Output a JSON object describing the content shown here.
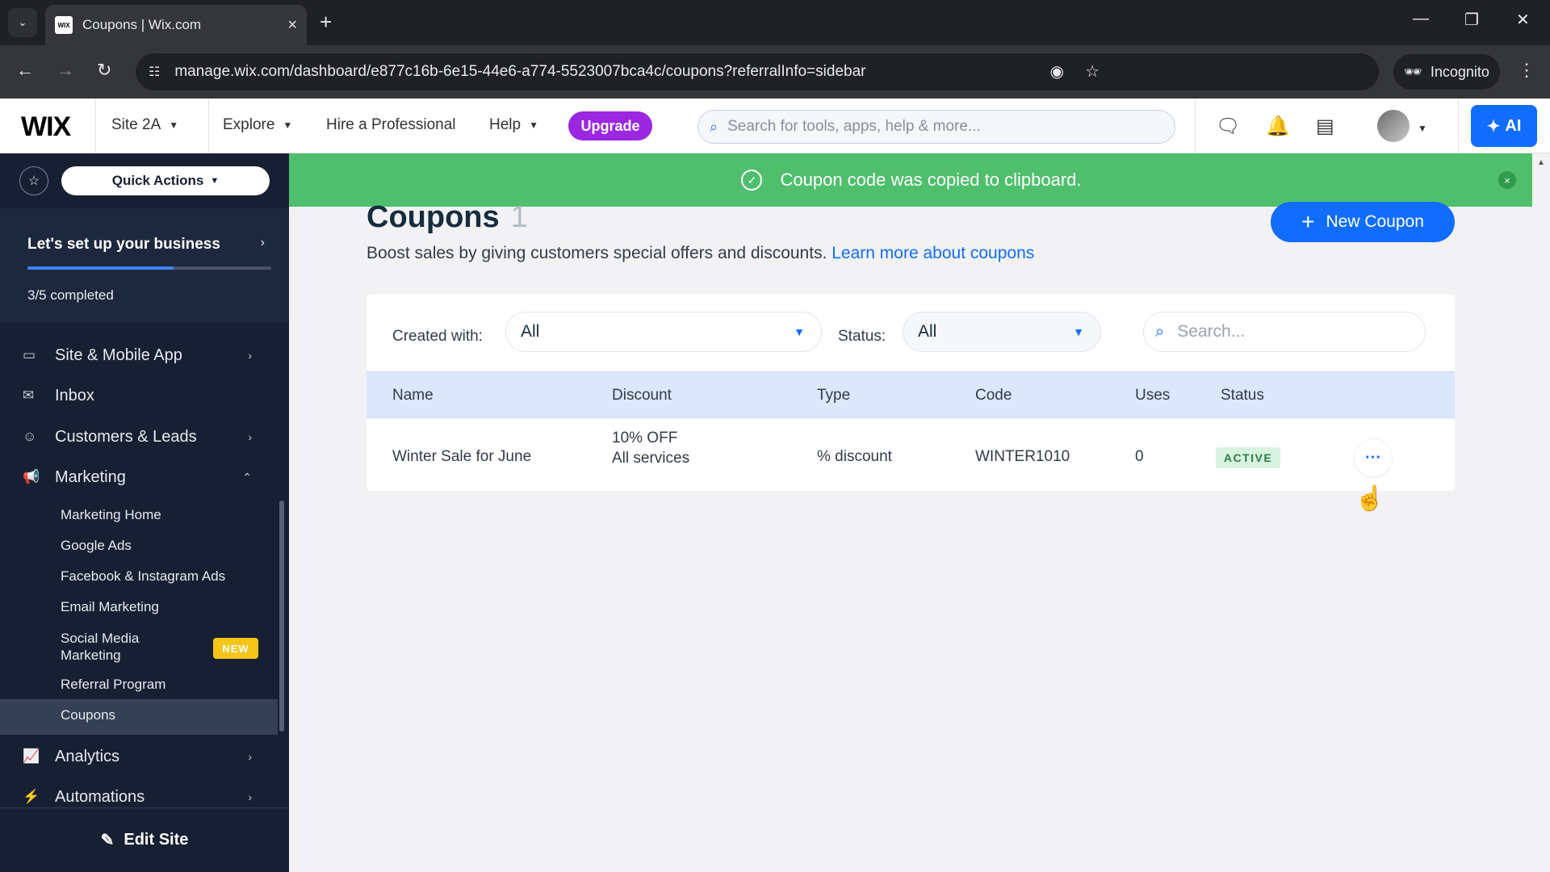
{
  "browser": {
    "tab_title": "Coupons | Wix.com",
    "favicon_text": "WIX",
    "url": "manage.wix.com/dashboard/e877c16b-6e15-44e6-a774-5523007bca4c/coupons?referralInfo=sidebar",
    "incognito_label": "Incognito"
  },
  "topbar": {
    "logo": "WIX",
    "site_name": "Site 2A",
    "explore": "Explore",
    "hire": "Hire a Professional",
    "help": "Help",
    "upgrade": "Upgrade",
    "search_placeholder": "Search for tools, apps, help & more...",
    "ai_label": "AI"
  },
  "sidebar": {
    "quick_actions": "Quick Actions",
    "setup_title": "Let's set up your business",
    "setup_progress_text": "3/5 completed",
    "setup_progress_fraction": 0.6,
    "items": [
      {
        "label": "Site & Mobile App",
        "icon": "site-icon"
      },
      {
        "label": "Inbox",
        "icon": "inbox-icon"
      },
      {
        "label": "Customers & Leads",
        "icon": "customers-icon"
      },
      {
        "label": "Marketing",
        "icon": "marketing-icon"
      },
      {
        "label": "Analytics",
        "icon": "analytics-icon"
      },
      {
        "label": "Automations",
        "icon": "automations-icon"
      }
    ],
    "marketing_sub": [
      "Marketing Home",
      "Google Ads",
      "Facebook & Instagram Ads",
      "Email Marketing",
      "Social Media Marketing",
      "Referral Program",
      "Coupons"
    ],
    "social_line1": "Social Media",
    "social_line2": "Marketing",
    "new_badge": "NEW",
    "edit_site": "Edit Site"
  },
  "toast": {
    "message": "Coupon code was copied to clipboard."
  },
  "page": {
    "title": "Coupons",
    "count": "1",
    "description": "Boost sales by giving customers special offers and discounts.",
    "learn_more": "Learn more about coupons",
    "new_coupon": "New Coupon"
  },
  "filters": {
    "created_with_label": "Created with:",
    "created_with_value": "All",
    "status_label": "Status:",
    "status_value": "All",
    "search_placeholder": "Search..."
  },
  "table": {
    "headers": [
      "Name",
      "Discount",
      "Type",
      "Code",
      "Uses",
      "Status"
    ],
    "rows": [
      {
        "name": "Winter Sale for June",
        "discount_line1": "10% OFF",
        "discount_line2": "All services",
        "type": "% discount",
        "code": "WINTER1010",
        "uses": "0",
        "status": "ACTIVE"
      }
    ]
  },
  "colors": {
    "accent": "#116dff",
    "toast_green": "#4fbf6d",
    "upgrade_purple": "#9c27e0",
    "sidebar_bg": "#172033"
  }
}
